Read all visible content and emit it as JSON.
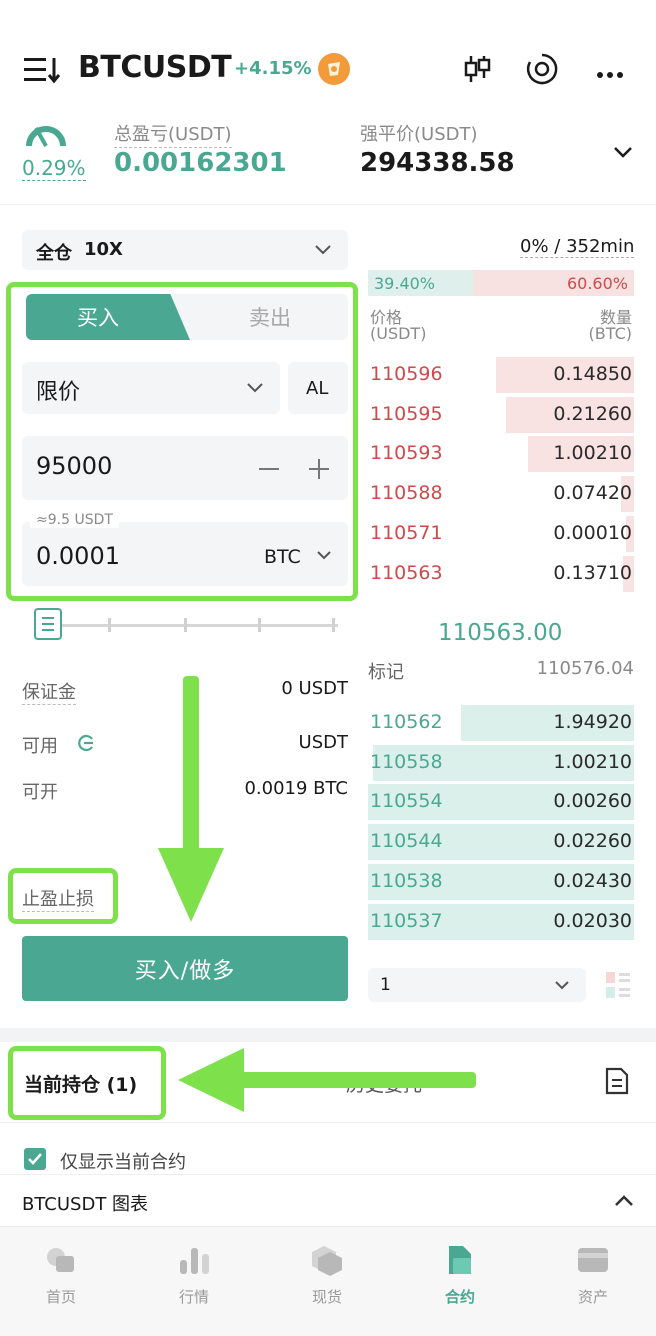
{
  "header": {
    "title": "BTCUSDT",
    "change_pct": "+4.15%",
    "icons": [
      "menu-icon",
      "candlestick-chart-icon",
      "eye-settings-icon",
      "more-icon"
    ]
  },
  "summary": {
    "risk_pct": "0.29%",
    "pnl_label": "总盈亏(USDT)",
    "pnl_value": "0.00162301",
    "liq_label": "强平价(USDT)",
    "liq_value": "294338.58"
  },
  "margin_mode": {
    "label": "全仓",
    "leverage": "10X"
  },
  "funding": "0% / 352min",
  "tabs": {
    "buy": "买入",
    "sell": "卖出"
  },
  "order_type": {
    "value": "限价",
    "extra": "AL"
  },
  "price_input": {
    "value": "95000"
  },
  "qty_input": {
    "hint": "≈9.5 USDT",
    "value": "0.0001",
    "unit": "BTC"
  },
  "info": {
    "margin_label": "保证金",
    "margin_value": "0 USDT",
    "avail_label": "可用",
    "avail_value": "USDT",
    "open_label": "可开",
    "open_value": "0.0019 BTC"
  },
  "tpsl_label": "止盈止损",
  "buy_button": "买入/做多",
  "orderbook": {
    "buy_ratio": "39.40%",
    "sell_ratio": "60.60%",
    "buy_ratio_fraction": 0.394,
    "price_header": "价格",
    "price_unit": "(USDT)",
    "qty_header": "数量",
    "qty_unit": "(BTC)",
    "asks": [
      {
        "price": "110596",
        "qty": "0.14850",
        "depth": 0.52
      },
      {
        "price": "110595",
        "qty": "0.21260",
        "depth": 0.48
      },
      {
        "price": "110593",
        "qty": "1.00210",
        "depth": 0.4
      },
      {
        "price": "110588",
        "qty": "0.07420",
        "depth": 0.05
      },
      {
        "price": "110571",
        "qty": "0.00010",
        "depth": 0.03
      },
      {
        "price": "110563",
        "qty": "0.13710",
        "depth": 0.04
      }
    ],
    "last_price": "110563.00",
    "mark_label": "标记",
    "mark_price": "110576.04",
    "bids": [
      {
        "price": "110562",
        "qty": "1.94920",
        "depth": 0.65
      },
      {
        "price": "110558",
        "qty": "1.00210",
        "depth": 0.98
      },
      {
        "price": "110554",
        "qty": "0.00260",
        "depth": 1.0
      },
      {
        "price": "110544",
        "qty": "0.02260",
        "depth": 1.0
      },
      {
        "price": "110538",
        "qty": "0.02430",
        "depth": 1.0
      },
      {
        "price": "110537",
        "qty": "0.02030",
        "depth": 1.0
      }
    ],
    "precision": "1"
  },
  "positions": {
    "tab_current": "当前持仓 (1)",
    "tab_orders": "历史委托",
    "only_current": "仅显示当前合约",
    "chart_row": "BTCUSDT 图表"
  },
  "nav": [
    {
      "label": "首页",
      "icon": "home-icon"
    },
    {
      "label": "行情",
      "icon": "market-icon"
    },
    {
      "label": "现货",
      "icon": "spot-icon"
    },
    {
      "label": "合约",
      "icon": "futures-icon"
    },
    {
      "label": "资产",
      "icon": "assets-icon"
    }
  ],
  "colors": {
    "accent": "#4aa892",
    "ask": "#cc4b4b",
    "highlight": "#7ee04a"
  }
}
